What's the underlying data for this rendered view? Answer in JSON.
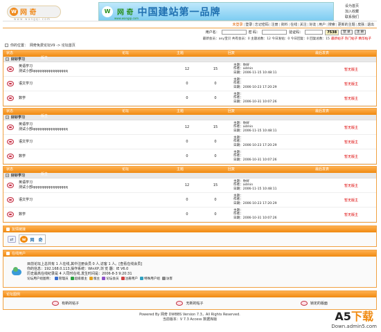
{
  "header": {
    "logo_text": "网 奇",
    "logo_url": "w w w . w a n g q i . c o m",
    "banner_logo_text": "网 奇",
    "banner_url": "www.wangqi.com",
    "banner_slogan": "中国建站第一品牌",
    "links": [
      "设为首页",
      "加入收藏",
      "联系我们"
    ]
  },
  "nav": {
    "items": [
      "未登录",
      "登录",
      "忘记密码",
      "注册",
      "资料",
      "在线",
      "关注",
      "好友",
      "用户",
      "搜索",
      "更新的主题",
      "皮肤",
      "退出"
    ]
  },
  "login": {
    "user_label": "用户名：",
    "pass_label": "密 码：",
    "code_label": "验证码：",
    "code": "7538",
    "login_btn": "登 录",
    "register_btn": "注 册"
  },
  "stats": {
    "text": "最新会员：any宝贝  共有会员：0  主题总数：12  今日发帖：0  今日回复：0  回复总数：15",
    "links": "最新帖子 热门帖子 精华帖子"
  },
  "position": {
    "label": "你的位置：",
    "path": "网奇免费论坛V9 -> 论坛首页"
  },
  "table_header": [
    "状态",
    "论坛",
    "主题",
    "回复",
    "最后发表",
    "版主"
  ],
  "categories": [
    {
      "title": "好好学习",
      "forums": [
        {
          "name": "英语学习",
          "desc": "测试小部qqqqqqqqqqqqqqqq",
          "topics": "12",
          "replies": "15",
          "last_title": "主题：你好",
          "last_author": "作者：admin",
          "last_date": "日期：2006-11-15 10:48:11",
          "moderator": "暂无版主"
        },
        {
          "name": "语文学习",
          "desc": "",
          "topics": "0",
          "replies": "0",
          "last_title": "主题：",
          "last_author": "作者：",
          "last_date": "日期：2006-10-23 17:20:29",
          "moderator": "暂无版主"
        },
        {
          "name": "数学",
          "desc": "",
          "topics": "0",
          "replies": "0",
          "last_title": "主题：",
          "last_author": "作者：",
          "last_date": "日期：2006-10-31 10:07:26",
          "moderator": "暂无版主"
        }
      ]
    },
    {
      "title": "好好学习",
      "forums": [
        {
          "name": "英语学习",
          "desc": "测试小部qqqqqqqqqqqqqqqq",
          "topics": "12",
          "replies": "15",
          "last_title": "主题：你好",
          "last_author": "作者：admin",
          "last_date": "日期：2006-11-15 10:48:11",
          "moderator": "暂无版主"
        },
        {
          "name": "语文学习",
          "desc": "",
          "topics": "0",
          "replies": "0",
          "last_title": "主题：",
          "last_author": "作者：",
          "last_date": "日期：2006-10-23 17:20:29",
          "moderator": "暂无版主"
        },
        {
          "name": "数学",
          "desc": "",
          "topics": "0",
          "replies": "0",
          "last_title": "主题：",
          "last_author": "作者：",
          "last_date": "日期：2006-10-31 10:07:26",
          "moderator": "暂无版主"
        }
      ]
    },
    {
      "title": "好好学习",
      "forums": [
        {
          "name": "英语学习",
          "desc": "测试小部qqqqqqqqqqqqqqqq",
          "topics": "12",
          "replies": "15",
          "last_title": "主题：你好",
          "last_author": "作者：admin",
          "last_date": "日期：2006-11-15 10:48:11",
          "moderator": "暂无版主"
        },
        {
          "name": "语文学习",
          "desc": "",
          "topics": "0",
          "replies": "0",
          "last_title": "主题：",
          "last_author": "作者：",
          "last_date": "日期：2006-10-23 17:20:29",
          "moderator": "暂无版主"
        },
        {
          "name": "数学",
          "desc": "",
          "topics": "0",
          "replies": "0",
          "last_title": "主题：",
          "last_author": "作者：",
          "last_date": "日期：2006-10-31 10:07:26",
          "moderator": "暂无版主"
        }
      ]
    }
  ],
  "friends_panel": {
    "title": "友情链接"
  },
  "online_panel": {
    "title": "在线用户",
    "line1": "目前论坛上总共有 1 人在线,其中注册会员 0 人,访客 1 人。[查看在线会员]",
    "line2": "你的信息：192.168.0.113,操作系统：WinXP,浏 览 器：IE V6.0",
    "line3": "历史最高在线纪录是 4 人同时在线,发生时间是：2006-8-3 9:20:31",
    "legend_label": "论坛用户组图例：",
    "legend": [
      "管理员",
      "超级版主",
      "版主",
      "论坛会员",
      "注册用户",
      "特殊用户组",
      "访客"
    ]
  },
  "example_panel": {
    "title": "论坛图例",
    "items": [
      "有新的帖子",
      "无新的帖子",
      "锁定的版面"
    ]
  },
  "footer": {
    "line1": "Powered By 网奇 DWBBS Version 7.3，All Rights Reserved.",
    "line2": "当前版本：V 7.3 Access 数据库版"
  },
  "watermark": {
    "brand_a": "A5",
    "brand_b": "下载",
    "url": "Down.admin5.com"
  },
  "colors": {
    "accent": "#f08a10",
    "moderator": "#dd0000"
  }
}
